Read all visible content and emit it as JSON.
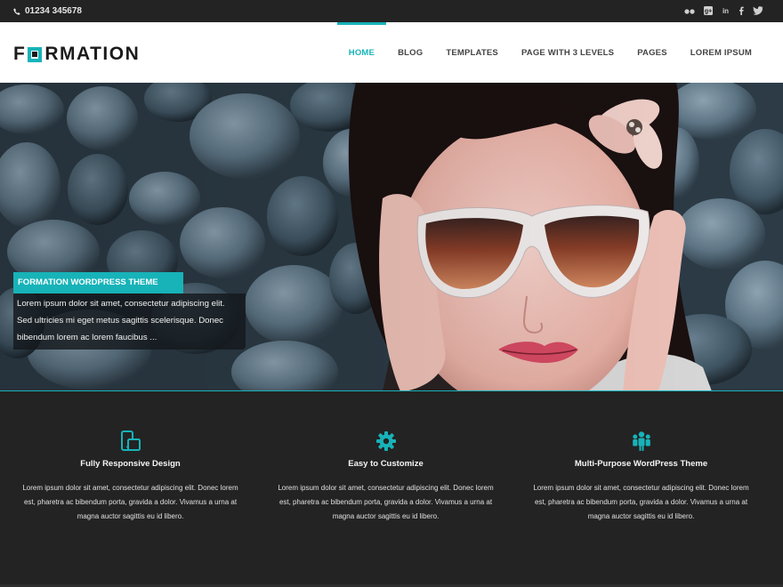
{
  "topbar": {
    "phone": "01234 345678",
    "social_icons": [
      "flickr-icon",
      "google-plus-icon",
      "linkedin-icon",
      "facebook-icon",
      "twitter-icon"
    ]
  },
  "logo": {
    "letter_f": "F",
    "letters_rest": "RMATION",
    "accent": "#17b3b8"
  },
  "nav": [
    "HOME",
    "BLOG",
    "TEMPLATES",
    "PAGE WITH 3 LEVELS",
    "PAGES",
    "LOREM IPSUM"
  ],
  "nav_active": "HOME",
  "hero": {
    "caption_title": "FORMATION WORDPRESS THEME",
    "caption_text": "Lorem ipsum dolor sit amet, consectetur adipiscing elit. Sed ultricies mi eget metus sagittis scelerisque. Donec bibendum lorem ac lorem faucibus ..."
  },
  "features": [
    {
      "icon": "mobile-tablet-icon",
      "title": "Fully Responsive Design",
      "text": "Lorem ipsum dolor sit amet, consectetur adipiscing elit. Donec lorem est, pharetra ac bibendum porta, gravida a dolor. Vivamus a urna at magna auctor sagittis eu id libero."
    },
    {
      "icon": "gear-icon",
      "title": "Easy to Customize",
      "text": "Lorem ipsum dolor sit amet, consectetur adipiscing elit. Donec lorem est, pharetra ac bibendum porta, gravida a dolor. Vivamus a urna at magna auctor sagittis eu id libero."
    },
    {
      "icon": "users-icon",
      "title": "Multi-Purpose WordPress Theme",
      "text": "Lorem ipsum dolor sit amet, consectetur adipiscing elit. Donec lorem est, pharetra ac bibendum porta, gravida a dolor. Vivamus a urna at magna auctor sagittis eu id libero."
    }
  ],
  "colors": {
    "accent": "#17b3b8",
    "topbar": "#232323",
    "features_bg": "#232323",
    "header_bg": "#ffffff"
  }
}
